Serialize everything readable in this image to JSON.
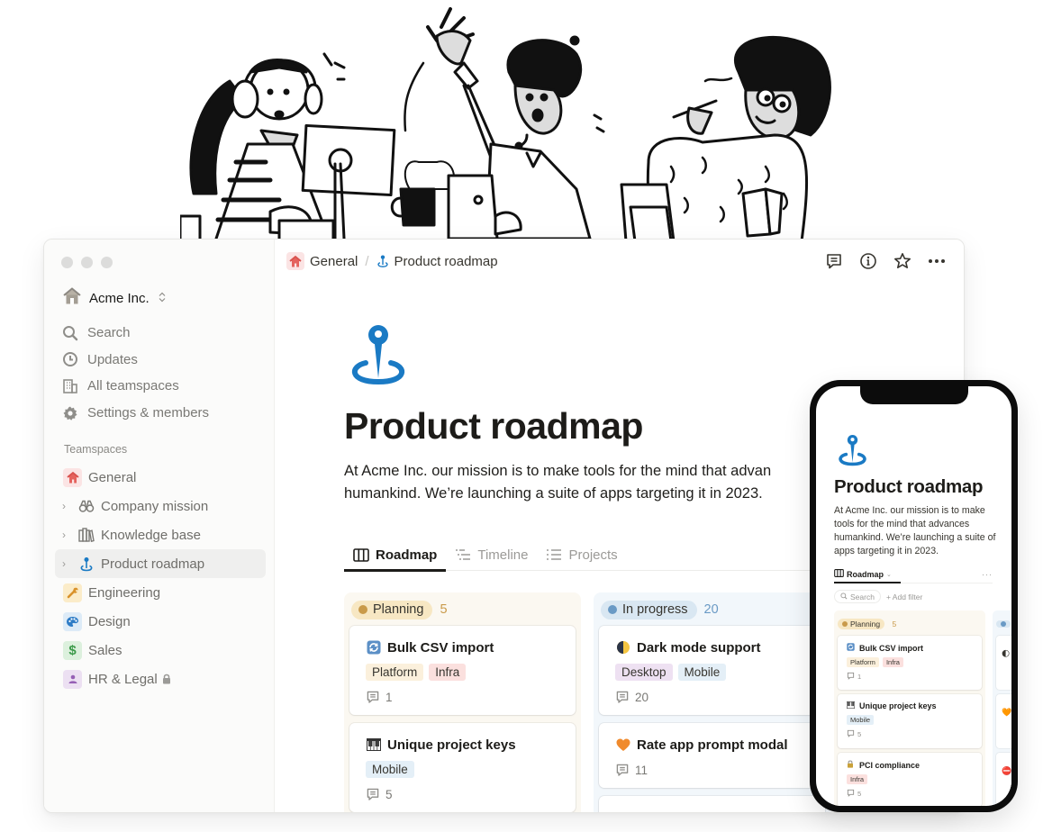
{
  "colors": {
    "accent_blue": "#1a7ac4",
    "planning_dot": "#c99a4a",
    "planning_pill": "#f7e7c3",
    "planning_count": "#c99a4a",
    "progress_dot": "#6a9ac5",
    "progress_pill": "#d9e7f2",
    "progress_count": "#6a9ac5",
    "tag_platform": "#fbf0dc",
    "tag_infra": "#fbe0de",
    "tag_mobile": "#e4eff7",
    "tag_desktop": "#eee1f2",
    "badge_general": "#fbe4e4",
    "badge_engineering": "#fbecc9",
    "badge_design": "#ddebf7",
    "badge_sales": "#dcf0dd",
    "badge_hr": "#ece0f2"
  },
  "window": {
    "traffic_lights": [
      "close",
      "minimize",
      "maximize"
    ]
  },
  "sidebar": {
    "workspace": {
      "name": "Acme Inc.",
      "icon": "house-icon",
      "switcher_icon": "chevron-up-down-icon"
    },
    "nav": [
      {
        "label": "Search",
        "icon": "search-icon"
      },
      {
        "label": "Updates",
        "icon": "clock-icon"
      },
      {
        "label": "All teamspaces",
        "icon": "building-icon"
      },
      {
        "label": "Settings & members",
        "icon": "gear-icon"
      }
    ],
    "teamspaces_label": "Teamspaces",
    "teamspaces": [
      {
        "label": "General",
        "icon": "house-icon",
        "type": "teamspace"
      },
      {
        "label": "Company mission",
        "icon": "binoculars-icon",
        "type": "page",
        "expandable": true
      },
      {
        "label": "Knowledge base",
        "icon": "books-icon",
        "type": "page",
        "expandable": true
      },
      {
        "label": "Product roadmap",
        "icon": "map-pin-icon",
        "type": "page",
        "expandable": true,
        "active": true
      },
      {
        "label": "Engineering",
        "icon": "wrench-icon",
        "type": "teamspace"
      },
      {
        "label": "Design",
        "icon": "palette-icon",
        "type": "teamspace"
      },
      {
        "label": "Sales",
        "icon": "dollar-icon",
        "type": "teamspace"
      },
      {
        "label": "HR & Legal",
        "icon": "person-icon",
        "type": "teamspace",
        "locked": true
      }
    ]
  },
  "topbar": {
    "breadcrumb": [
      {
        "label": "General",
        "icon": "house-icon"
      },
      {
        "label": "Product roadmap",
        "icon": "map-pin-icon"
      }
    ],
    "separator": "/",
    "actions": [
      "comment-icon",
      "info-icon",
      "star-icon",
      "more-icon"
    ]
  },
  "page": {
    "icon": "map-pin-icon",
    "title": "Product roadmap",
    "description": "At Acme Inc. our mission is to make tools for the mind that advances humankind. We’re launching a suite of apps targeting it in 2023.",
    "description_line1": "At Acme Inc. our mission is to make tools for the mind that advan",
    "description_line2": "humankind. We’re launching a suite of apps targeting it in 2023.",
    "tabs": [
      {
        "label": "Roadmap",
        "icon": "board-icon",
        "active": true
      },
      {
        "label": "Timeline",
        "icon": "timeline-icon",
        "active": false
      },
      {
        "label": "Projects",
        "icon": "list-icon",
        "active": false
      }
    ]
  },
  "board": {
    "columns": [
      {
        "status": "Planning",
        "count": "5",
        "cards": [
          {
            "title": "Bulk CSV import",
            "emoji": "🔄",
            "tags": [
              "Platform",
              "Infra"
            ],
            "comments": "1"
          },
          {
            "title": "Unique project keys",
            "emoji": "🎹",
            "tags": [
              "Mobile"
            ],
            "comments": "5"
          }
        ]
      },
      {
        "status": "In progress",
        "count": "20",
        "cards": [
          {
            "title": "Dark mode support",
            "emoji": "🌓",
            "tags": [
              "Desktop",
              "Mobile"
            ],
            "comments": "20"
          },
          {
            "title": "Rate app prompt modal",
            "emoji": "🧡",
            "tags": [],
            "comments": "11"
          }
        ]
      }
    ]
  },
  "mobile": {
    "title": "Product roadmap",
    "description": "At Acme Inc. our mission is to make tools for the mind that advances humankind. We’re launching a suite of apps targeting it in 2023.",
    "view_tab": "Roadmap",
    "more": "···",
    "search_placeholder": "Search",
    "add_filter": "+ Add filter",
    "planning": {
      "status": "Planning",
      "count": "5",
      "cards": [
        {
          "title": "Bulk CSV import",
          "emoji": "🔄",
          "tags": [
            "Platform",
            "Infra"
          ],
          "comments": "1"
        },
        {
          "title": "Unique project keys",
          "emoji": "🎹",
          "tags": [
            "Mobile"
          ],
          "comments": "5"
        },
        {
          "title": "PCI compliance",
          "emoji": "🔒",
          "tags": [
            "Infra"
          ],
          "comments": "5"
        }
      ]
    }
  }
}
